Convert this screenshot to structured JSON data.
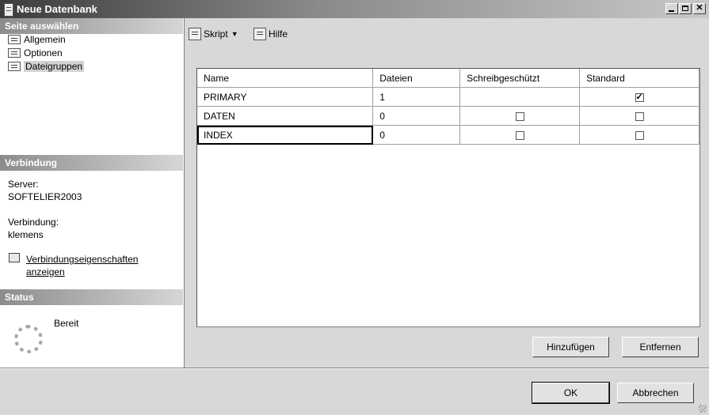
{
  "window": {
    "title": "Neue Datenbank"
  },
  "left_panel": {
    "select_page_header": "Seite auswählen",
    "nav_items": [
      {
        "label": "Allgemein",
        "selected": false
      },
      {
        "label": "Optionen",
        "selected": false
      },
      {
        "label": "Dateigruppen",
        "selected": true
      }
    ],
    "connection_header": "Verbindung",
    "server_label": "Server:",
    "server_value": "SOFTELIER2003",
    "connection_label": "Verbindung:",
    "connection_value": "klemens",
    "connection_link": "Verbindungseigenschaften anzeigen",
    "status_header": "Status",
    "status_text": "Bereit"
  },
  "toolbar": {
    "script_label": "Skript",
    "help_label": "Hilfe"
  },
  "grid": {
    "columns": [
      "Name",
      "Dateien",
      "Schreibgeschützt",
      "Standard"
    ],
    "rows": [
      {
        "name": "PRIMARY",
        "files": "1",
        "readonly": null,
        "default": true
      },
      {
        "name": "DATEN",
        "files": "0",
        "readonly": false,
        "default": false
      },
      {
        "name": "INDEX",
        "files": "0",
        "readonly": false,
        "default": false
      }
    ]
  },
  "buttons": {
    "add": "Hinzufügen",
    "remove": "Entfernen",
    "ok": "OK",
    "cancel": "Abbrechen"
  }
}
